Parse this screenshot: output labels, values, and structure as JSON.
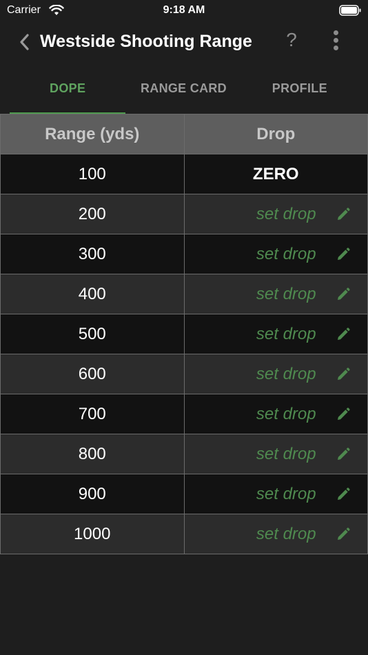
{
  "status_bar": {
    "carrier": "Carrier",
    "time": "9:18 AM",
    "icons": [
      "wifi-icon",
      "battery-icon"
    ]
  },
  "nav": {
    "back_icon": "chevron-left-icon",
    "title": "Westside Shooting Range",
    "help_label": "?",
    "more_icon": "more-vertical-icon"
  },
  "tabs": [
    {
      "label": "DOPE",
      "active": true
    },
    {
      "label": "RANGE CARD",
      "active": false
    },
    {
      "label": "PROFILE",
      "active": false
    }
  ],
  "table": {
    "headers": {
      "range": "Range (yds)",
      "drop": "Drop"
    },
    "rows": [
      {
        "range": "100",
        "drop": "ZERO"
      },
      {
        "range": "200",
        "drop": "set drop"
      },
      {
        "range": "300",
        "drop": "set drop"
      },
      {
        "range": "400",
        "drop": "set drop"
      },
      {
        "range": "500",
        "drop": "set drop"
      },
      {
        "range": "600",
        "drop": "set drop"
      },
      {
        "range": "700",
        "drop": "set drop"
      },
      {
        "range": "800",
        "drop": "set drop"
      },
      {
        "range": "900",
        "drop": "set drop"
      },
      {
        "range": "1000",
        "drop": "set drop"
      }
    ]
  },
  "colors": {
    "background": "#1e1e1e",
    "accent_green": "#5fa35f",
    "set_drop_green": "#4f8a4f",
    "header_bg": "#5e5e5e",
    "row_dark": "#121212",
    "row_light": "#2c2c2c"
  }
}
